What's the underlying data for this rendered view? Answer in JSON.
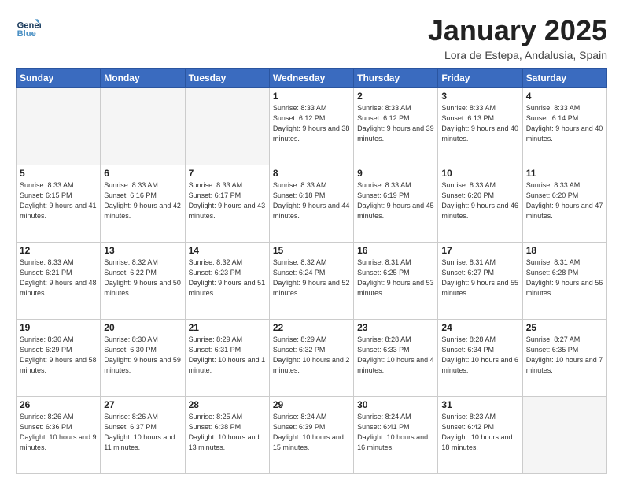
{
  "header": {
    "logo_line1": "General",
    "logo_line2": "Blue",
    "title": "January 2025",
    "location": "Lora de Estepa, Andalusia, Spain"
  },
  "weekdays": [
    "Sunday",
    "Monday",
    "Tuesday",
    "Wednesday",
    "Thursday",
    "Friday",
    "Saturday"
  ],
  "weeks": [
    [
      {
        "day": "",
        "info": ""
      },
      {
        "day": "",
        "info": ""
      },
      {
        "day": "",
        "info": ""
      },
      {
        "day": "1",
        "info": "Sunrise: 8:33 AM\nSunset: 6:12 PM\nDaylight: 9 hours\nand 38 minutes."
      },
      {
        "day": "2",
        "info": "Sunrise: 8:33 AM\nSunset: 6:12 PM\nDaylight: 9 hours\nand 39 minutes."
      },
      {
        "day": "3",
        "info": "Sunrise: 8:33 AM\nSunset: 6:13 PM\nDaylight: 9 hours\nand 40 minutes."
      },
      {
        "day": "4",
        "info": "Sunrise: 8:33 AM\nSunset: 6:14 PM\nDaylight: 9 hours\nand 40 minutes."
      }
    ],
    [
      {
        "day": "5",
        "info": "Sunrise: 8:33 AM\nSunset: 6:15 PM\nDaylight: 9 hours\nand 41 minutes."
      },
      {
        "day": "6",
        "info": "Sunrise: 8:33 AM\nSunset: 6:16 PM\nDaylight: 9 hours\nand 42 minutes."
      },
      {
        "day": "7",
        "info": "Sunrise: 8:33 AM\nSunset: 6:17 PM\nDaylight: 9 hours\nand 43 minutes."
      },
      {
        "day": "8",
        "info": "Sunrise: 8:33 AM\nSunset: 6:18 PM\nDaylight: 9 hours\nand 44 minutes."
      },
      {
        "day": "9",
        "info": "Sunrise: 8:33 AM\nSunset: 6:19 PM\nDaylight: 9 hours\nand 45 minutes."
      },
      {
        "day": "10",
        "info": "Sunrise: 8:33 AM\nSunset: 6:20 PM\nDaylight: 9 hours\nand 46 minutes."
      },
      {
        "day": "11",
        "info": "Sunrise: 8:33 AM\nSunset: 6:20 PM\nDaylight: 9 hours\nand 47 minutes."
      }
    ],
    [
      {
        "day": "12",
        "info": "Sunrise: 8:33 AM\nSunset: 6:21 PM\nDaylight: 9 hours\nand 48 minutes."
      },
      {
        "day": "13",
        "info": "Sunrise: 8:32 AM\nSunset: 6:22 PM\nDaylight: 9 hours\nand 50 minutes."
      },
      {
        "day": "14",
        "info": "Sunrise: 8:32 AM\nSunset: 6:23 PM\nDaylight: 9 hours\nand 51 minutes."
      },
      {
        "day": "15",
        "info": "Sunrise: 8:32 AM\nSunset: 6:24 PM\nDaylight: 9 hours\nand 52 minutes."
      },
      {
        "day": "16",
        "info": "Sunrise: 8:31 AM\nSunset: 6:25 PM\nDaylight: 9 hours\nand 53 minutes."
      },
      {
        "day": "17",
        "info": "Sunrise: 8:31 AM\nSunset: 6:27 PM\nDaylight: 9 hours\nand 55 minutes."
      },
      {
        "day": "18",
        "info": "Sunrise: 8:31 AM\nSunset: 6:28 PM\nDaylight: 9 hours\nand 56 minutes."
      }
    ],
    [
      {
        "day": "19",
        "info": "Sunrise: 8:30 AM\nSunset: 6:29 PM\nDaylight: 9 hours\nand 58 minutes."
      },
      {
        "day": "20",
        "info": "Sunrise: 8:30 AM\nSunset: 6:30 PM\nDaylight: 9 hours\nand 59 minutes."
      },
      {
        "day": "21",
        "info": "Sunrise: 8:29 AM\nSunset: 6:31 PM\nDaylight: 10 hours\nand 1 minute."
      },
      {
        "day": "22",
        "info": "Sunrise: 8:29 AM\nSunset: 6:32 PM\nDaylight: 10 hours\nand 2 minutes."
      },
      {
        "day": "23",
        "info": "Sunrise: 8:28 AM\nSunset: 6:33 PM\nDaylight: 10 hours\nand 4 minutes."
      },
      {
        "day": "24",
        "info": "Sunrise: 8:28 AM\nSunset: 6:34 PM\nDaylight: 10 hours\nand 6 minutes."
      },
      {
        "day": "25",
        "info": "Sunrise: 8:27 AM\nSunset: 6:35 PM\nDaylight: 10 hours\nand 7 minutes."
      }
    ],
    [
      {
        "day": "26",
        "info": "Sunrise: 8:26 AM\nSunset: 6:36 PM\nDaylight: 10 hours\nand 9 minutes."
      },
      {
        "day": "27",
        "info": "Sunrise: 8:26 AM\nSunset: 6:37 PM\nDaylight: 10 hours\nand 11 minutes."
      },
      {
        "day": "28",
        "info": "Sunrise: 8:25 AM\nSunset: 6:38 PM\nDaylight: 10 hours\nand 13 minutes."
      },
      {
        "day": "29",
        "info": "Sunrise: 8:24 AM\nSunset: 6:39 PM\nDaylight: 10 hours\nand 15 minutes."
      },
      {
        "day": "30",
        "info": "Sunrise: 8:24 AM\nSunset: 6:41 PM\nDaylight: 10 hours\nand 16 minutes."
      },
      {
        "day": "31",
        "info": "Sunrise: 8:23 AM\nSunset: 6:42 PM\nDaylight: 10 hours\nand 18 minutes."
      },
      {
        "day": "",
        "info": ""
      }
    ]
  ]
}
